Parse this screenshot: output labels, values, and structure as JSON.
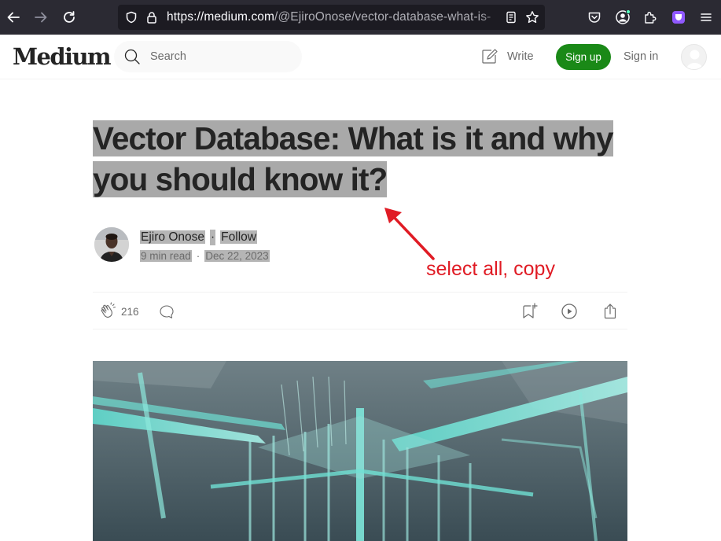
{
  "browser": {
    "url_host": "https://medium.com",
    "url_path": "/@EjiroOnose/vector-database-what-is-"
  },
  "header": {
    "logo": "Medium",
    "search_placeholder": "Search",
    "write_label": "Write",
    "signup_label": "Sign up",
    "signin_label": "Sign in"
  },
  "article": {
    "title": "Vector Database: What is it and why you should know it?",
    "author": "Ejiro Onose",
    "follow_label": "Follow",
    "read_time": "9 min read",
    "date": "Dec 22, 2023",
    "claps": "216"
  },
  "annotation": {
    "text": "select all, copy",
    "color": "#e01b24"
  },
  "colors": {
    "brand_green": "#1a8917",
    "selection_gray": "#a9a9a9",
    "hero_teal": "#5fd3c8"
  }
}
